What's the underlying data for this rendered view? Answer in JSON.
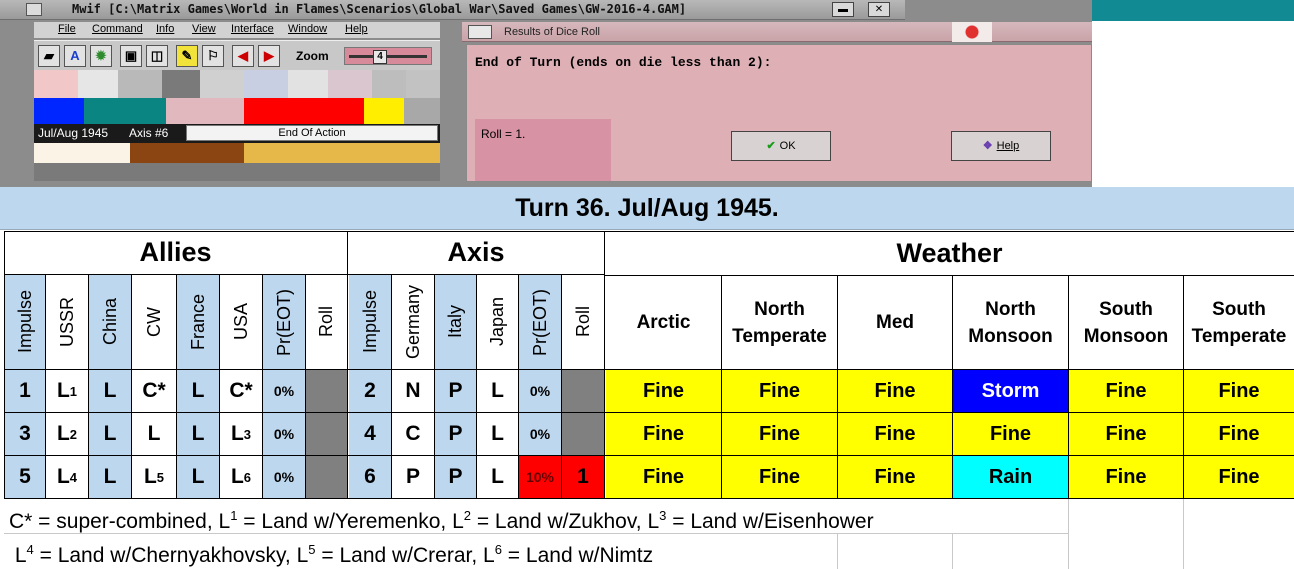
{
  "app": {
    "title": "Mwif [C:\\Matrix Games\\World in Flames\\Scenarios\\Global War\\Saved Games\\GW-2016-4.GAM]",
    "menu": [
      "File",
      "Command",
      "Info",
      "View",
      "Interface",
      "Window",
      "Help"
    ],
    "zoom_label": "Zoom",
    "zoom_value": "4",
    "status_date": "Jul/Aug 1945",
    "status_axis": "Axis #6",
    "status_action": "End Of Action"
  },
  "dialog": {
    "title": "Results of Dice Roll",
    "question": "End of Turn (ends on die less than 2):",
    "roll": "Roll = 1.",
    "ok_label": "OK",
    "help_label": "Help"
  },
  "table": {
    "title": "Turn 36.  Jul/Aug 1945.",
    "allies_header": "Allies",
    "axis_header": "Axis",
    "weather_header": "Weather",
    "allies_cols": [
      "Impulse",
      "USSR",
      "China",
      "CW",
      "France",
      "USA",
      "Pr(EOT)",
      "Roll"
    ],
    "axis_cols": [
      "Impulse",
      "Germany",
      "Italy",
      "Japan",
      "Pr(EOT)",
      "Roll"
    ],
    "zones": [
      {
        "l1": "Arctic",
        "l2": ""
      },
      {
        "l1": "North",
        "l2": "Temperate"
      },
      {
        "l1": "Med",
        "l2": ""
      },
      {
        "l1": "North",
        "l2": "Monsoon"
      },
      {
        "l1": "South",
        "l2": "Monsoon"
      },
      {
        "l1": "South",
        "l2": "Temperate"
      }
    ],
    "rows": [
      {
        "allies": {
          "impulse": "1",
          "ussr": "L",
          "ussr_sup": "1",
          "china": "L",
          "cw": "C*",
          "cw_sup": "",
          "france": "L",
          "usa": "C*",
          "usa_sup": "",
          "pr": "0%",
          "roll": ""
        },
        "axis": {
          "impulse": "2",
          "germany": "N",
          "italy": "P",
          "japan": "L",
          "pr": "0%",
          "roll": ""
        },
        "weather": [
          "Fine",
          "Fine",
          "Fine",
          "Storm",
          "Fine",
          "Fine"
        ]
      },
      {
        "allies": {
          "impulse": "3",
          "ussr": "L",
          "ussr_sup": "2",
          "china": "L",
          "cw": "L",
          "cw_sup": "",
          "france": "L",
          "usa": "L",
          "usa_sup": "3",
          "pr": "0%",
          "roll": ""
        },
        "axis": {
          "impulse": "4",
          "germany": "C",
          "italy": "P",
          "japan": "L",
          "pr": "0%",
          "roll": ""
        },
        "weather": [
          "Fine",
          "Fine",
          "Fine",
          "Fine",
          "Fine",
          "Fine"
        ]
      },
      {
        "allies": {
          "impulse": "5",
          "ussr": "L",
          "ussr_sup": "4",
          "china": "L",
          "cw": "L",
          "cw_sup": "5",
          "france": "L",
          "usa": "L",
          "usa_sup": "6",
          "pr": "0%",
          "roll": ""
        },
        "axis": {
          "impulse": "6",
          "germany": "P",
          "italy": "P",
          "japan": "L",
          "pr": "10%",
          "roll": "1"
        },
        "weather": [
          "Fine",
          "Fine",
          "Fine",
          "Rain",
          "Fine",
          "Fine"
        ]
      }
    ],
    "notes": {
      "line1": {
        "a": "C* = super-combined, L",
        "s1": "1",
        "b": " = Land w/Yeremenko, L",
        "s2": "2",
        "c": " = Land w/Zukhov, L",
        "s3": "3",
        "d": " = Land w/Eisenhower"
      },
      "line2": {
        "a": " L",
        "s1": "4",
        "b": " = Land w/Chernyakhovsky, L",
        "s2": "5",
        "c": " = Land w/Crerar, L",
        "s3": "6",
        "d": " = Land w/Nimtz"
      }
    }
  },
  "colors": {
    "header_blue": "#bdd7ee",
    "fine_yellow": "#ffff00",
    "storm_blue": "#0000ff",
    "rain_cyan": "#00ffff",
    "roll_red": "#ff0000",
    "roll_grey": "#808080",
    "dialog_pink": "#deb0b6"
  }
}
